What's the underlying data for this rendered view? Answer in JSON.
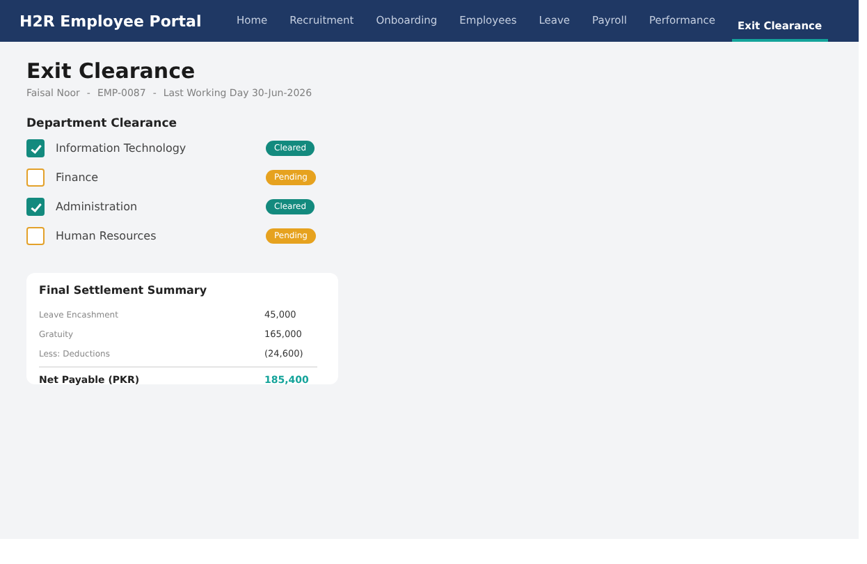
{
  "header": {
    "title": "H2R Employee Portal",
    "nav": [
      {
        "label": "Home",
        "selected": false
      },
      {
        "label": "Recruitment",
        "selected": false
      },
      {
        "label": "Onboarding",
        "selected": false
      },
      {
        "label": "Employees",
        "selected": false
      },
      {
        "label": "Leave",
        "selected": false
      },
      {
        "label": "Payroll",
        "selected": false
      },
      {
        "label": "Performance",
        "selected": false
      },
      {
        "label": "Exit Clearance",
        "selected": true
      }
    ]
  },
  "page": {
    "title": "Exit Clearance",
    "meta": [
      "Faisal Noor",
      "EMP-0087",
      "Last Working Day 30-Jun-2026"
    ],
    "separator": "-"
  },
  "clearance": {
    "heading": "Department Clearance",
    "items": [
      {
        "department": "Information Technology",
        "checked": true,
        "status": "Cleared"
      },
      {
        "department": "Finance",
        "checked": false,
        "status": "Pending"
      },
      {
        "department": "Administration",
        "checked": true,
        "status": "Cleared"
      },
      {
        "department": "Human Resources",
        "checked": false,
        "status": "Pending"
      }
    ]
  },
  "settlement": {
    "title": "Final Settlement Summary",
    "rows": [
      {
        "label": "Leave Encashment",
        "value": "45,000"
      },
      {
        "label": "Gratuity",
        "value": "165,000"
      },
      {
        "label": "Less: Deductions",
        "value": "(24,600)"
      }
    ],
    "total": {
      "label": "Net Payable (PKR)",
      "value": "185,400"
    }
  }
}
